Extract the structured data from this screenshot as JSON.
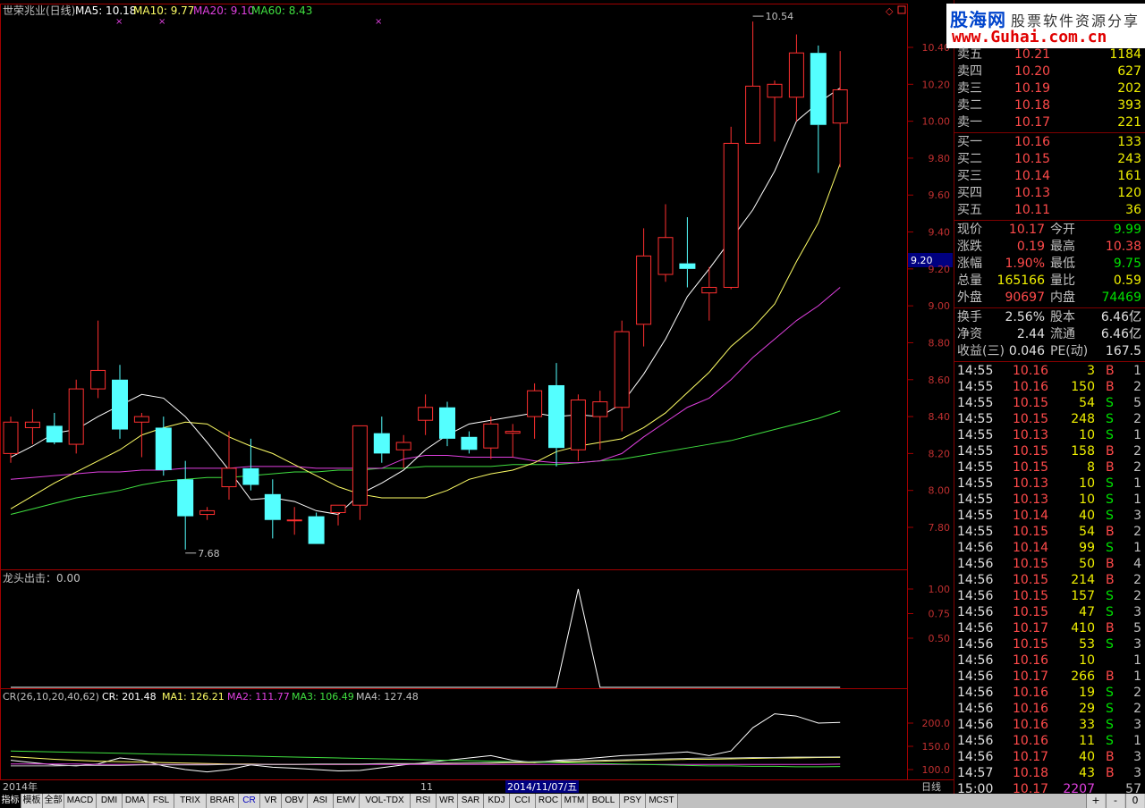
{
  "stock_name": "世荣兆业(日线)",
  "ma_legend": {
    "ma5": "MA5: 10.18",
    "ma10": "MA10: 9.77",
    "ma20": "MA20: 9.10",
    "ma60": "MA60: 8.43"
  },
  "indicator2_legend": "龙头出击：0.00",
  "cr_legend": {
    "head": "CR(26,10,20,40,62)",
    "cr": "CR: 201.48",
    "ma1": "MA1: 126.21",
    "ma2": "MA2: 111.77",
    "ma3": "MA3: 106.49",
    "ma4": "MA4: 127.48"
  },
  "price_marker": "9.20",
  "high_label": "10.54",
  "low_label": "7.68",
  "period_label": "日线",
  "date_bar": {
    "year": "2014年",
    "month": "11",
    "selected_date": "2014/11/07/五"
  },
  "logo": {
    "site": "股海网",
    "slogan": "股票软件资源分享",
    "url": "www.Guhai.com.cn"
  },
  "colors": {
    "up": "#ff3030",
    "down": "#54ffff",
    "ma5": "#ffffff",
    "ma10": "#ffff66",
    "ma20": "#e040e0",
    "ma60": "#40e040",
    "frame": "#a00000"
  },
  "chart_data": [
    {
      "type": "candlestick",
      "title": "世荣兆业(日线)",
      "y_ticks": [
        "10.40",
        "10.20",
        "10.00",
        "9.80",
        "9.60",
        "9.40",
        "9.20",
        "9.00",
        "8.80",
        "8.60",
        "8.40",
        "8.20",
        "8.00",
        "7.80"
      ],
      "ylim": [
        7.6,
        10.6
      ],
      "candles": [
        {
          "o": 8.2,
          "h": 8.4,
          "l": 8.15,
          "c": 8.37
        },
        {
          "o": 8.34,
          "h": 8.44,
          "l": 8.25,
          "c": 8.37
        },
        {
          "o": 8.35,
          "h": 8.42,
          "l": 8.25,
          "c": 8.26
        },
        {
          "o": 8.25,
          "h": 8.6,
          "l": 8.2,
          "c": 8.55
        },
        {
          "o": 8.55,
          "h": 8.92,
          "l": 8.5,
          "c": 8.65
        },
        {
          "o": 8.6,
          "h": 8.68,
          "l": 8.28,
          "c": 8.33
        },
        {
          "o": 8.37,
          "h": 8.42,
          "l": 8.18,
          "c": 8.4
        },
        {
          "o": 8.34,
          "h": 8.4,
          "l": 8.08,
          "c": 8.11
        },
        {
          "o": 8.06,
          "h": 8.16,
          "l": 7.68,
          "c": 7.86
        },
        {
          "o": 7.87,
          "h": 7.91,
          "l": 7.84,
          "c": 7.89
        },
        {
          "o": 8.02,
          "h": 8.32,
          "l": 7.95,
          "c": 8.12
        },
        {
          "o": 8.12,
          "h": 8.28,
          "l": 8.0,
          "c": 8.03
        },
        {
          "o": 7.98,
          "h": 8.06,
          "l": 7.74,
          "c": 7.84
        },
        {
          "o": 7.84,
          "h": 7.91,
          "l": 7.76,
          "c": 7.84
        },
        {
          "o": 7.86,
          "h": 7.88,
          "l": 7.71,
          "c": 7.71
        },
        {
          "o": 7.88,
          "h": 7.92,
          "l": 7.81,
          "c": 7.92
        },
        {
          "o": 7.92,
          "h": 8.35,
          "l": 7.84,
          "c": 8.35
        },
        {
          "o": 8.31,
          "h": 8.4,
          "l": 8.15,
          "c": 8.2
        },
        {
          "o": 8.22,
          "h": 8.3,
          "l": 8.12,
          "c": 8.26
        },
        {
          "o": 8.38,
          "h": 8.52,
          "l": 8.3,
          "c": 8.45
        },
        {
          "o": 8.45,
          "h": 8.48,
          "l": 8.24,
          "c": 8.28
        },
        {
          "o": 8.29,
          "h": 8.32,
          "l": 8.2,
          "c": 8.22
        },
        {
          "o": 8.23,
          "h": 8.4,
          "l": 8.17,
          "c": 8.36
        },
        {
          "o": 8.31,
          "h": 8.36,
          "l": 8.18,
          "c": 8.32
        },
        {
          "o": 8.4,
          "h": 8.58,
          "l": 8.28,
          "c": 8.54
        },
        {
          "o": 8.57,
          "h": 8.69,
          "l": 8.13,
          "c": 8.23
        },
        {
          "o": 8.22,
          "h": 8.52,
          "l": 8.16,
          "c": 8.49
        },
        {
          "o": 8.4,
          "h": 8.54,
          "l": 8.22,
          "c": 8.48
        },
        {
          "o": 8.45,
          "h": 8.92,
          "l": 8.32,
          "c": 8.86
        },
        {
          "o": 8.9,
          "h": 9.42,
          "l": 8.78,
          "c": 9.27
        },
        {
          "o": 9.17,
          "h": 9.55,
          "l": 9.13,
          "c": 9.37
        },
        {
          "o": 9.23,
          "h": 9.48,
          "l": 9.1,
          "c": 9.2
        },
        {
          "o": 9.07,
          "h": 9.21,
          "l": 8.92,
          "c": 9.1
        },
        {
          "o": 9.1,
          "h": 9.97,
          "l": 9.09,
          "c": 9.88
        },
        {
          "o": 9.88,
          "h": 10.54,
          "l": 9.88,
          "c": 10.19
        },
        {
          "o": 10.13,
          "h": 10.22,
          "l": 9.89,
          "c": 10.2
        },
        {
          "o": 10.13,
          "h": 10.47,
          "l": 10.0,
          "c": 10.37
        },
        {
          "o": 10.37,
          "h": 10.41,
          "l": 9.72,
          "c": 9.98
        },
        {
          "o": 9.99,
          "h": 10.38,
          "l": 9.75,
          "c": 10.17
        }
      ],
      "ma5": [
        8.18,
        8.24,
        8.31,
        8.33,
        8.4,
        8.46,
        8.52,
        8.5,
        8.4,
        8.26,
        8.11,
        7.95,
        7.96,
        7.94,
        7.89,
        7.87,
        7.98,
        8.04,
        8.11,
        8.22,
        8.3,
        8.36,
        8.38,
        8.4,
        8.42,
        8.4,
        8.41,
        8.4,
        8.47,
        8.63,
        8.82,
        9.05,
        9.2,
        9.36,
        9.52,
        9.73,
        10.0,
        10.1,
        10.18
      ],
      "ma10": [
        7.9,
        7.97,
        8.04,
        8.1,
        8.16,
        8.22,
        8.3,
        8.34,
        8.37,
        8.36,
        8.29,
        8.24,
        8.2,
        8.14,
        8.08,
        8.02,
        7.98,
        7.96,
        7.96,
        7.96,
        8.0,
        8.06,
        8.09,
        8.11,
        8.15,
        8.21,
        8.24,
        8.26,
        8.28,
        8.34,
        8.42,
        8.53,
        8.64,
        8.78,
        8.88,
        9.01,
        9.24,
        9.45,
        9.77
      ],
      "ma20": [
        8.06,
        8.07,
        8.08,
        8.09,
        8.1,
        8.1,
        8.11,
        8.11,
        8.12,
        8.12,
        8.12,
        8.13,
        8.13,
        8.13,
        8.12,
        8.12,
        8.12,
        8.12,
        8.17,
        8.19,
        8.19,
        8.18,
        8.18,
        8.18,
        8.16,
        8.15,
        8.15,
        8.16,
        8.2,
        8.29,
        8.37,
        8.45,
        8.5,
        8.6,
        8.72,
        8.82,
        8.92,
        9.0,
        9.1
      ],
      "ma60": [
        7.87,
        7.9,
        7.93,
        7.96,
        7.98,
        8.0,
        8.03,
        8.05,
        8.06,
        8.07,
        8.07,
        8.08,
        8.09,
        8.1,
        8.1,
        8.11,
        8.11,
        8.12,
        8.12,
        8.13,
        8.13,
        8.13,
        8.13,
        8.14,
        8.14,
        8.14,
        8.15,
        8.16,
        8.17,
        8.19,
        8.21,
        8.23,
        8.25,
        8.27,
        8.3,
        8.33,
        8.36,
        8.39,
        8.43
      ],
      "high_annotation": {
        "index": 34,
        "value": 10.54
      },
      "low_annotation": {
        "index": 8,
        "value": 7.68
      }
    },
    {
      "type": "line",
      "title": "龙头出击",
      "y_ticks": [
        "1.00",
        "0.75",
        "0.50"
      ],
      "ylim": [
        0,
        1.0
      ],
      "values": [
        0,
        0,
        0,
        0,
        0,
        0,
        0,
        0,
        0,
        0,
        0,
        0,
        0,
        0,
        0,
        0,
        0,
        0,
        0,
        0,
        0,
        0,
        0,
        0,
        0,
        0,
        1,
        0,
        0,
        0,
        0,
        0,
        0,
        0,
        0,
        0,
        0,
        0,
        0
      ]
    },
    {
      "type": "line",
      "title": "CR(26,10,20,40,62)",
      "y_ticks": [
        "200.0",
        "150.0",
        "100.0"
      ],
      "ylim": [
        95,
        240
      ],
      "series": [
        {
          "name": "CR",
          "values": [
            120,
            115,
            110,
            108,
            112,
            125,
            120,
            108,
            100,
            95,
            100,
            110,
            105,
            103,
            100,
            97,
            98,
            104,
            110,
            115,
            120,
            125,
            130,
            120,
            115,
            120,
            122,
            126,
            130,
            132,
            135,
            138,
            130,
            140,
            190,
            220,
            215,
            200,
            201.48
          ]
        },
        {
          "name": "MA1",
          "values": [
            128,
            125,
            122,
            120,
            118,
            117,
            116,
            115,
            114,
            113,
            112,
            112,
            111,
            111,
            111,
            111,
            111,
            112,
            112,
            113,
            113,
            114,
            114,
            115,
            115,
            116,
            117,
            118,
            119,
            120,
            121,
            122,
            122,
            123,
            124,
            125,
            125,
            126,
            126.21
          ]
        },
        {
          "name": "MA2",
          "values": [
            112,
            112,
            112,
            112,
            111,
            111,
            111,
            111,
            111,
            111,
            111,
            111,
            111,
            111,
            111,
            111,
            111,
            111,
            111,
            111,
            111,
            111,
            111,
            111,
            111,
            111,
            111,
            111,
            111,
            111,
            111,
            111,
            111,
            111,
            111,
            111,
            111,
            111,
            111.77
          ]
        },
        {
          "name": "MA3",
          "values": [
            140,
            139,
            138,
            137,
            136,
            135,
            134,
            133,
            132,
            131,
            130,
            129,
            128,
            127,
            126,
            125,
            124,
            123,
            122,
            121,
            120,
            119,
            118,
            117,
            116,
            115,
            114,
            113,
            112,
            111,
            110,
            109,
            108,
            108,
            107,
            107,
            106,
            106,
            106.49
          ]
        },
        {
          "name": "MA4",
          "values": [
            108,
            108,
            108,
            109,
            109,
            109,
            110,
            110,
            110,
            110,
            111,
            111,
            111,
            111,
            112,
            112,
            112,
            113,
            113,
            113,
            114,
            114,
            115,
            116,
            117,
            118,
            119,
            120,
            121,
            122,
            123,
            124,
            125,
            125,
            126,
            126,
            127,
            127,
            127.48
          ]
        }
      ]
    }
  ],
  "order_book": {
    "asks": [
      {
        "label": "卖五",
        "price": "10.21",
        "vol": "1184"
      },
      {
        "label": "卖四",
        "price": "10.20",
        "vol": "627"
      },
      {
        "label": "卖三",
        "price": "10.19",
        "vol": "202"
      },
      {
        "label": "卖二",
        "price": "10.18",
        "vol": "393"
      },
      {
        "label": "卖一",
        "price": "10.17",
        "vol": "221"
      }
    ],
    "bids": [
      {
        "label": "买一",
        "price": "10.16",
        "vol": "133"
      },
      {
        "label": "买二",
        "price": "10.15",
        "vol": "243"
      },
      {
        "label": "买三",
        "price": "10.14",
        "vol": "161"
      },
      {
        "label": "买四",
        "price": "10.13",
        "vol": "120"
      },
      {
        "label": "买五",
        "price": "10.11",
        "vol": "36"
      }
    ]
  },
  "quote": [
    {
      "l1": "现价",
      "v1": "10.17",
      "c1": "red",
      "l2": "今开",
      "v2": "9.99",
      "c2": "green"
    },
    {
      "l1": "涨跌",
      "v1": "0.19",
      "c1": "red",
      "l2": "最高",
      "v2": "10.38",
      "c2": "red"
    },
    {
      "l1": "涨幅",
      "v1": "1.90%",
      "c1": "red",
      "l2": "最低",
      "v2": "9.75",
      "c2": "green"
    },
    {
      "l1": "总量",
      "v1": "165166",
      "c1": "yellow",
      "l2": "量比",
      "v2": "0.59",
      "c2": "yellow"
    },
    {
      "l1": "外盘",
      "v1": "90697",
      "c1": "red",
      "l2": "内盘",
      "v2": "74469",
      "c2": "green"
    }
  ],
  "fundamentals": [
    {
      "l1": "换手",
      "v1": "2.56%",
      "l2": "股本",
      "v2": "6.46亿"
    },
    {
      "l1": "净资",
      "v1": "2.44",
      "l2": "流通",
      "v2": "6.46亿"
    },
    {
      "l1": "收益(三)",
      "v1": "0.046",
      "l2": "PE(动)",
      "v2": "167.5"
    }
  ],
  "ticks": [
    {
      "t": "14:55",
      "p": "10.16",
      "pc": "red",
      "v": "3",
      "d": "B",
      "n": "1"
    },
    {
      "t": "14:55",
      "p": "10.16",
      "pc": "red",
      "v": "150",
      "d": "B",
      "n": "2"
    },
    {
      "t": "14:55",
      "p": "10.15",
      "pc": "red",
      "v": "54",
      "d": "S",
      "n": "5"
    },
    {
      "t": "14:55",
      "p": "10.15",
      "pc": "red",
      "v": "248",
      "d": "S",
      "n": "2"
    },
    {
      "t": "14:55",
      "p": "10.13",
      "pc": "red",
      "v": "10",
      "d": "S",
      "n": "1"
    },
    {
      "t": "14:55",
      "p": "10.15",
      "pc": "red",
      "v": "158",
      "d": "B",
      "n": "2"
    },
    {
      "t": "14:55",
      "p": "10.15",
      "pc": "red",
      "v": "8",
      "d": "B",
      "n": "2"
    },
    {
      "t": "14:55",
      "p": "10.13",
      "pc": "red",
      "v": "10",
      "d": "S",
      "n": "1"
    },
    {
      "t": "14:55",
      "p": "10.13",
      "pc": "red",
      "v": "10",
      "d": "S",
      "n": "1"
    },
    {
      "t": "14:55",
      "p": "10.14",
      "pc": "red",
      "v": "40",
      "d": "S",
      "n": "3"
    },
    {
      "t": "14:55",
      "p": "10.15",
      "pc": "red",
      "v": "54",
      "d": "B",
      "n": "2"
    },
    {
      "t": "14:56",
      "p": "10.14",
      "pc": "red",
      "v": "99",
      "d": "S",
      "n": "1"
    },
    {
      "t": "14:56",
      "p": "10.15",
      "pc": "red",
      "v": "50",
      "d": "B",
      "n": "4"
    },
    {
      "t": "14:56",
      "p": "10.15",
      "pc": "red",
      "v": "214",
      "d": "B",
      "n": "2"
    },
    {
      "t": "14:56",
      "p": "10.15",
      "pc": "red",
      "v": "157",
      "d": "S",
      "n": "2"
    },
    {
      "t": "14:56",
      "p": "10.15",
      "pc": "red",
      "v": "47",
      "d": "S",
      "n": "3"
    },
    {
      "t": "14:56",
      "p": "10.17",
      "pc": "red",
      "v": "410",
      "d": "B",
      "n": "5"
    },
    {
      "t": "14:56",
      "p": "10.15",
      "pc": "red",
      "v": "53",
      "d": "S",
      "n": "3"
    },
    {
      "t": "14:56",
      "p": "10.16",
      "pc": "red",
      "v": "10",
      "d": "",
      "n": "1"
    },
    {
      "t": "14:56",
      "p": "10.17",
      "pc": "red",
      "v": "266",
      "d": "B",
      "n": "1"
    },
    {
      "t": "14:56",
      "p": "10.16",
      "pc": "red",
      "v": "19",
      "d": "S",
      "n": "2"
    },
    {
      "t": "14:56",
      "p": "10.16",
      "pc": "red",
      "v": "29",
      "d": "S",
      "n": "2"
    },
    {
      "t": "14:56",
      "p": "10.16",
      "pc": "red",
      "v": "33",
      "d": "S",
      "n": "3"
    },
    {
      "t": "14:56",
      "p": "10.16",
      "pc": "red",
      "v": "11",
      "d": "S",
      "n": "1"
    },
    {
      "t": "14:56",
      "p": "10.17",
      "pc": "red",
      "v": "40",
      "d": "B",
      "n": "3"
    },
    {
      "t": "14:57",
      "p": "10.18",
      "pc": "red",
      "v": "43",
      "d": "B",
      "n": "3"
    },
    {
      "t": "15:00",
      "p": "10.17",
      "pc": "red",
      "v": "2207",
      "d": "",
      "n": "57"
    }
  ],
  "tabs": [
    "指标",
    "模板",
    "全部",
    "MACD",
    "DMI",
    "DMA",
    "FSL",
    "TRIX",
    "BRAR",
    "CR",
    "VR",
    "OBV",
    "ASI",
    "EMV",
    "VOL-TDX",
    "RSI",
    "WR",
    "SAR",
    "KDJ",
    "CCI",
    "ROC",
    "MTM",
    "BOLL",
    "PSY",
    "MCST"
  ],
  "selected_tab": "指标",
  "active_indicator_tab": "CR",
  "controls": [
    "+",
    "-",
    "0"
  ]
}
